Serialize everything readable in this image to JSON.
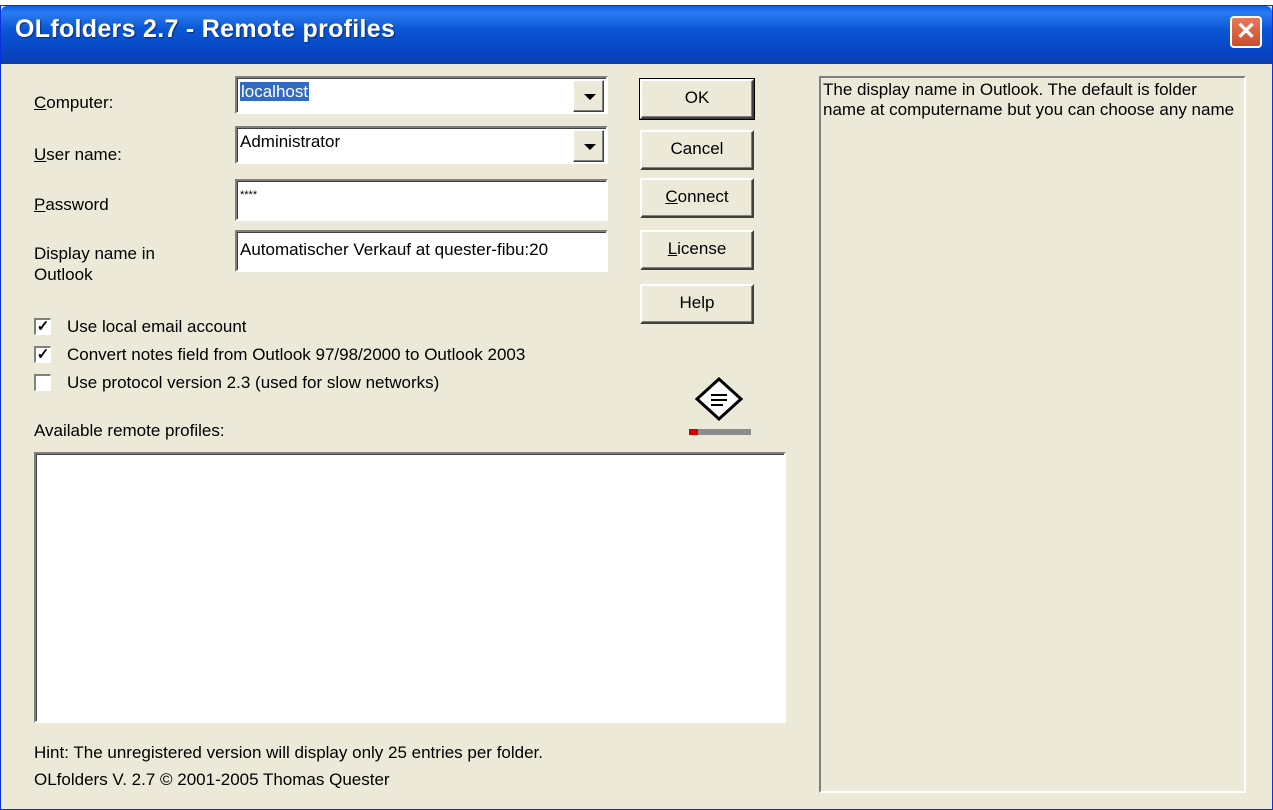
{
  "window": {
    "title": "OLfolders 2.7 - Remote profiles",
    "close": "✕"
  },
  "form": {
    "computer": {
      "label_accel": "C",
      "label_rest": "omputer:",
      "value": "localhost"
    },
    "username": {
      "label_accel": "U",
      "label_rest": "ser name:",
      "value": "Administrator"
    },
    "password": {
      "label_accel": "P",
      "label_rest": "assword",
      "value": "****"
    },
    "display_name": {
      "label": "Display name in Outlook",
      "value": "Automatischer Verkauf at quester-fibu:20"
    }
  },
  "buttons": {
    "ok": "OK",
    "cancel": "Cancel",
    "connect_accel": "C",
    "connect_rest": "onnect",
    "license_accel": "L",
    "license_rest": "icense",
    "help": "Help"
  },
  "options": [
    {
      "label": "Use local email account",
      "checked": true
    },
    {
      "label": "Convert notes field from Outlook 97/98/2000 to Outlook 2003",
      "checked": true
    },
    {
      "label": "Use protocol version 2.3 (used for slow networks)",
      "checked": false
    }
  ],
  "profiles": {
    "label": "Available remote profiles:",
    "items": []
  },
  "footer": {
    "hint": "Hint: The unregistered version will display only 25 entries per folder.",
    "copyright": "OLfolders V. 2.7 © 2001-2005 Thomas Quester"
  },
  "help_panel": {
    "text": "The display name in Outlook. The default is folder name at computername but you can choose any name"
  },
  "icons": {
    "logo": "olfolders-logo-icon"
  }
}
